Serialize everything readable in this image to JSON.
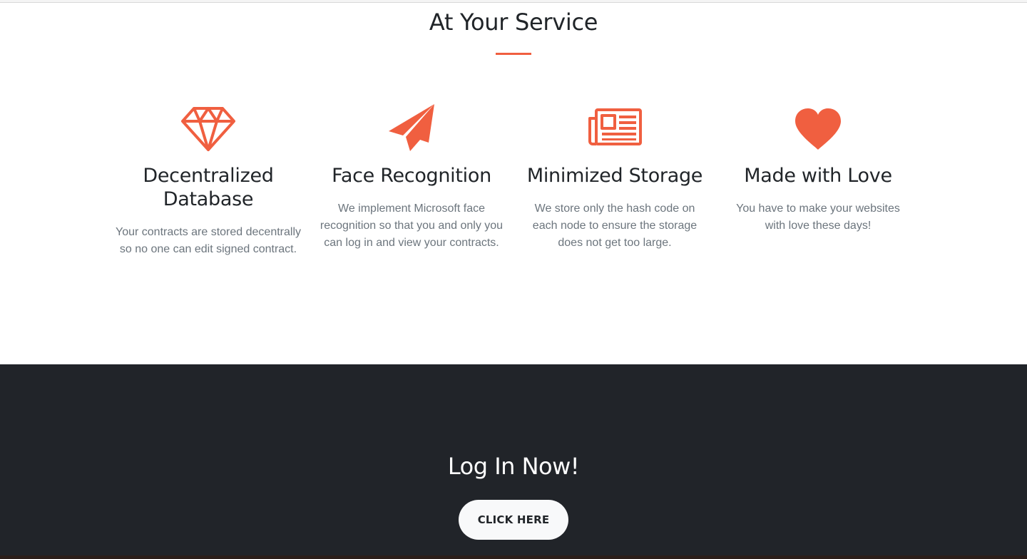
{
  "services": {
    "title": "At Your Service",
    "accent_color": "#f05f40",
    "features": [
      {
        "icon": "diamond-icon",
        "title": "Decentralized Database",
        "description": "Your contracts are stored decentrally so no one can edit signed contract."
      },
      {
        "icon": "paper-plane-icon",
        "title": "Face Recognition",
        "description": "We implement Microsoft face recognition so that you and only you can log in and view your contracts."
      },
      {
        "icon": "newspaper-icon",
        "title": "Minimized Storage",
        "description": "We store only the hash code on each node to ensure the storage does not get too large."
      },
      {
        "icon": "heart-icon",
        "title": "Made with Love",
        "description": "You have to make your websites with love these days!"
      }
    ]
  },
  "cta": {
    "title": "Log In Now!",
    "button_label": "CLICK HERE",
    "background_color": "#212429"
  }
}
